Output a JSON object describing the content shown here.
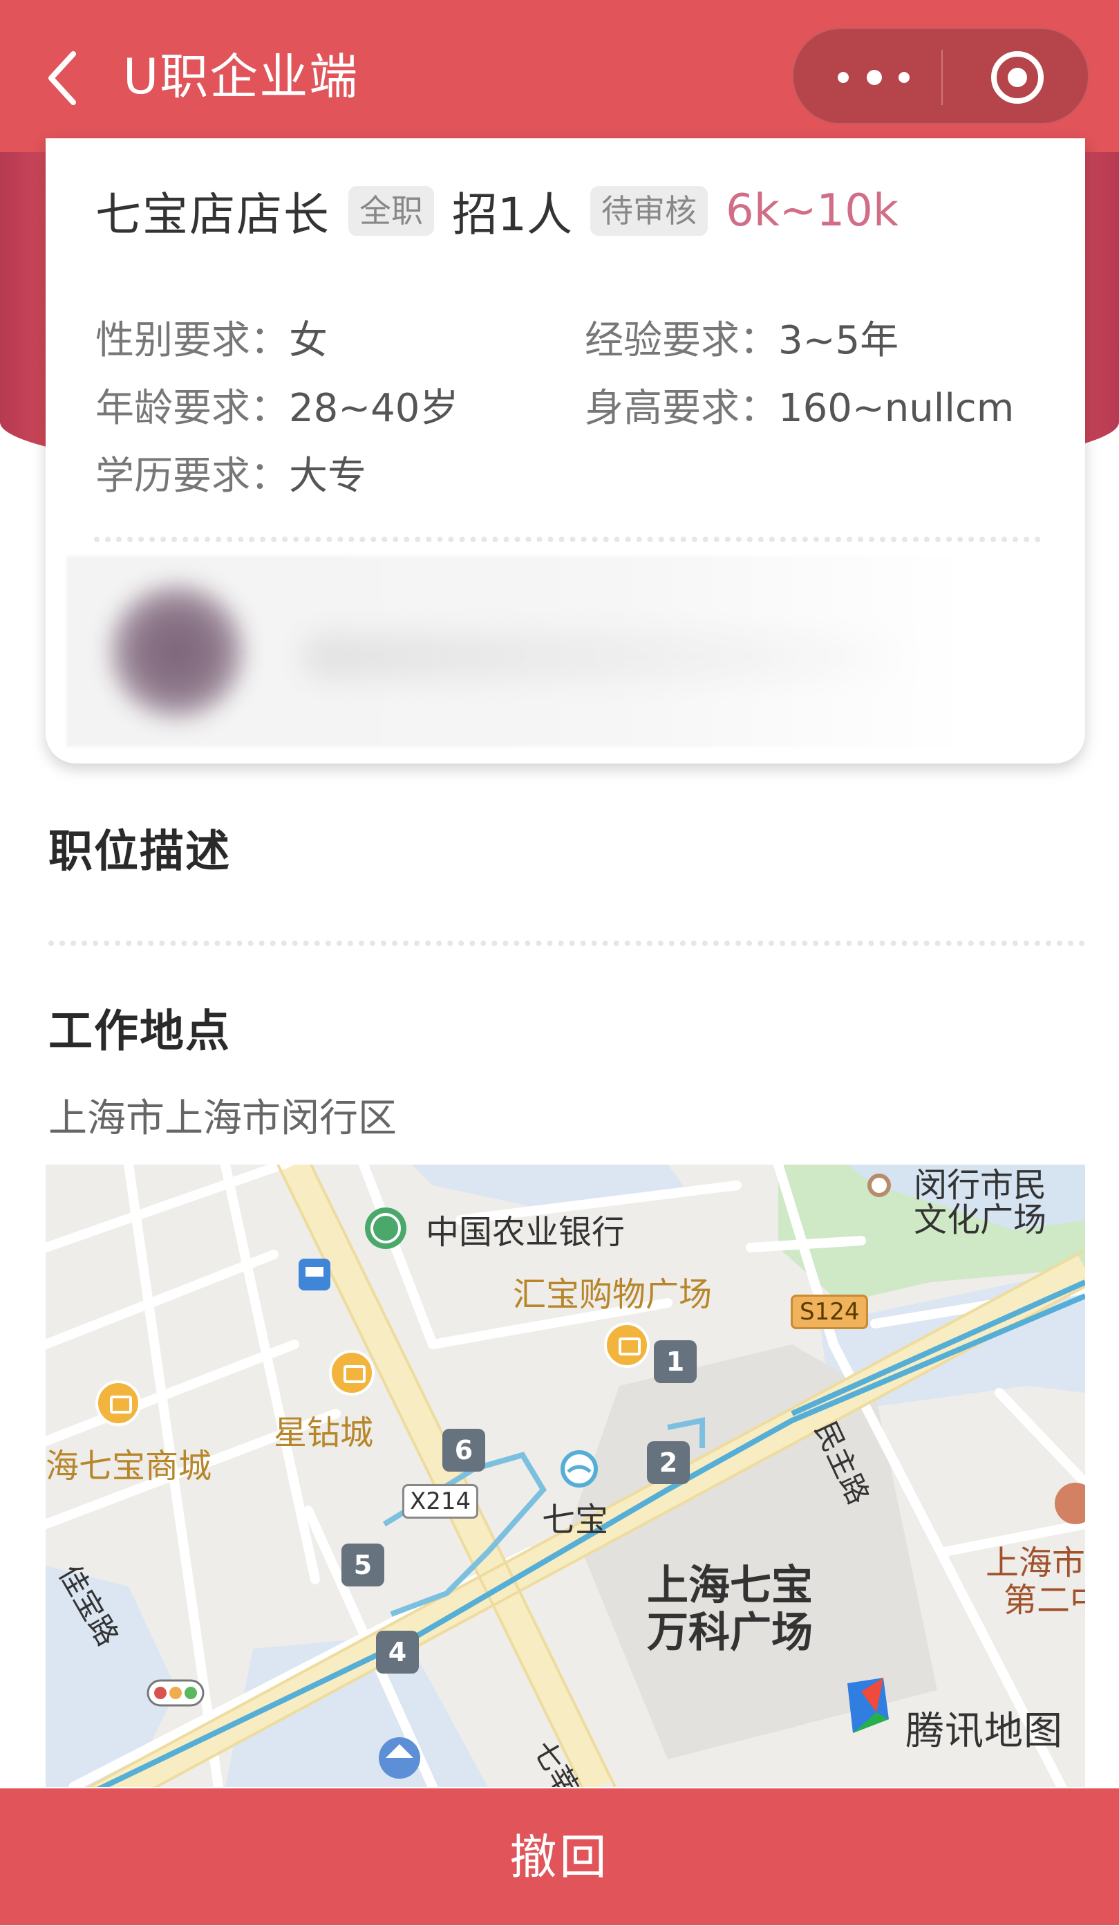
{
  "header": {
    "title": "U职企业端",
    "back_icon": "chevron-left-icon",
    "more_icon": "more-dots-icon",
    "close_icon": "target-circle-icon"
  },
  "job": {
    "title": "七宝店店长",
    "type_tag": "全职",
    "hire_count": "招1人",
    "status_tag": "待审核",
    "salary": "6k~10k"
  },
  "requirements": [
    {
      "label": "性别要求：",
      "value": "女"
    },
    {
      "label": "经验要求：",
      "value": "3~5年"
    },
    {
      "label": "年龄要求：",
      "value": "28~40岁"
    },
    {
      "label": "身高要求：",
      "value": "160~nullcm"
    },
    {
      "label": "学历要求：",
      "value": "大专"
    }
  ],
  "sections": {
    "description_title": "职位描述",
    "location_title": "工作地点",
    "address": "上海市上海市闵行区"
  },
  "map": {
    "labels": {
      "bank": "中国农业银行",
      "huibao": "汇宝购物广场",
      "xingzuan": "星钻城",
      "qibao_mall": "海七宝商城",
      "qibao_station": "七宝",
      "vanke": "上海七宝",
      "vanke2": "万科广场",
      "culture": "闵行市民",
      "culture2": "文化广场",
      "minzhu": "民主路",
      "jiabao": "佳宝路",
      "qixin": "七莘",
      "right_poi": "上海市",
      "right_poi2": "第二中",
      "road_x214": "X214",
      "road_s124": "S124",
      "brand": "腾讯地图"
    },
    "exits": [
      "1",
      "2",
      "4",
      "5",
      "6"
    ]
  },
  "footer": {
    "withdraw_label": "撤回"
  },
  "colors": {
    "brand_red": "#e0545a",
    "salary_pink": "#cf6e86"
  }
}
